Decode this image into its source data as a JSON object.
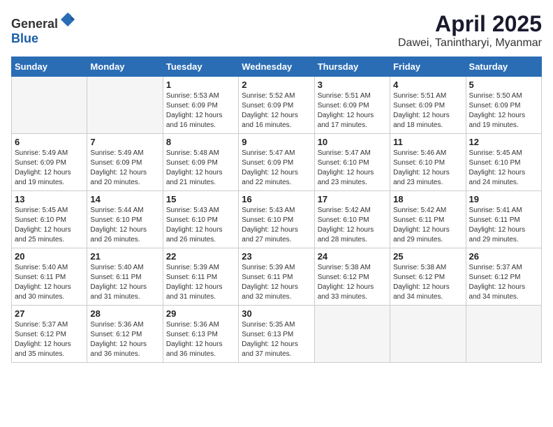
{
  "logo": {
    "text_general": "General",
    "text_blue": "Blue"
  },
  "header": {
    "month": "April 2025",
    "location": "Dawei, Tanintharyi, Myanmar"
  },
  "weekdays": [
    "Sunday",
    "Monday",
    "Tuesday",
    "Wednesday",
    "Thursday",
    "Friday",
    "Saturday"
  ],
  "weeks": [
    [
      {
        "day": "",
        "sunrise": "",
        "sunset": "",
        "daylight": ""
      },
      {
        "day": "",
        "sunrise": "",
        "sunset": "",
        "daylight": ""
      },
      {
        "day": "1",
        "sunrise": "Sunrise: 5:53 AM",
        "sunset": "Sunset: 6:09 PM",
        "daylight": "Daylight: 12 hours and 16 minutes."
      },
      {
        "day": "2",
        "sunrise": "Sunrise: 5:52 AM",
        "sunset": "Sunset: 6:09 PM",
        "daylight": "Daylight: 12 hours and 16 minutes."
      },
      {
        "day": "3",
        "sunrise": "Sunrise: 5:51 AM",
        "sunset": "Sunset: 6:09 PM",
        "daylight": "Daylight: 12 hours and 17 minutes."
      },
      {
        "day": "4",
        "sunrise": "Sunrise: 5:51 AM",
        "sunset": "Sunset: 6:09 PM",
        "daylight": "Daylight: 12 hours and 18 minutes."
      },
      {
        "day": "5",
        "sunrise": "Sunrise: 5:50 AM",
        "sunset": "Sunset: 6:09 PM",
        "daylight": "Daylight: 12 hours and 19 minutes."
      }
    ],
    [
      {
        "day": "6",
        "sunrise": "Sunrise: 5:49 AM",
        "sunset": "Sunset: 6:09 PM",
        "daylight": "Daylight: 12 hours and 19 minutes."
      },
      {
        "day": "7",
        "sunrise": "Sunrise: 5:49 AM",
        "sunset": "Sunset: 6:09 PM",
        "daylight": "Daylight: 12 hours and 20 minutes."
      },
      {
        "day": "8",
        "sunrise": "Sunrise: 5:48 AM",
        "sunset": "Sunset: 6:09 PM",
        "daylight": "Daylight: 12 hours and 21 minutes."
      },
      {
        "day": "9",
        "sunrise": "Sunrise: 5:47 AM",
        "sunset": "Sunset: 6:09 PM",
        "daylight": "Daylight: 12 hours and 22 minutes."
      },
      {
        "day": "10",
        "sunrise": "Sunrise: 5:47 AM",
        "sunset": "Sunset: 6:10 PM",
        "daylight": "Daylight: 12 hours and 23 minutes."
      },
      {
        "day": "11",
        "sunrise": "Sunrise: 5:46 AM",
        "sunset": "Sunset: 6:10 PM",
        "daylight": "Daylight: 12 hours and 23 minutes."
      },
      {
        "day": "12",
        "sunrise": "Sunrise: 5:45 AM",
        "sunset": "Sunset: 6:10 PM",
        "daylight": "Daylight: 12 hours and 24 minutes."
      }
    ],
    [
      {
        "day": "13",
        "sunrise": "Sunrise: 5:45 AM",
        "sunset": "Sunset: 6:10 PM",
        "daylight": "Daylight: 12 hours and 25 minutes."
      },
      {
        "day": "14",
        "sunrise": "Sunrise: 5:44 AM",
        "sunset": "Sunset: 6:10 PM",
        "daylight": "Daylight: 12 hours and 26 minutes."
      },
      {
        "day": "15",
        "sunrise": "Sunrise: 5:43 AM",
        "sunset": "Sunset: 6:10 PM",
        "daylight": "Daylight: 12 hours and 26 minutes."
      },
      {
        "day": "16",
        "sunrise": "Sunrise: 5:43 AM",
        "sunset": "Sunset: 6:10 PM",
        "daylight": "Daylight: 12 hours and 27 minutes."
      },
      {
        "day": "17",
        "sunrise": "Sunrise: 5:42 AM",
        "sunset": "Sunset: 6:10 PM",
        "daylight": "Daylight: 12 hours and 28 minutes."
      },
      {
        "day": "18",
        "sunrise": "Sunrise: 5:42 AM",
        "sunset": "Sunset: 6:11 PM",
        "daylight": "Daylight: 12 hours and 29 minutes."
      },
      {
        "day": "19",
        "sunrise": "Sunrise: 5:41 AM",
        "sunset": "Sunset: 6:11 PM",
        "daylight": "Daylight: 12 hours and 29 minutes."
      }
    ],
    [
      {
        "day": "20",
        "sunrise": "Sunrise: 5:40 AM",
        "sunset": "Sunset: 6:11 PM",
        "daylight": "Daylight: 12 hours and 30 minutes."
      },
      {
        "day": "21",
        "sunrise": "Sunrise: 5:40 AM",
        "sunset": "Sunset: 6:11 PM",
        "daylight": "Daylight: 12 hours and 31 minutes."
      },
      {
        "day": "22",
        "sunrise": "Sunrise: 5:39 AM",
        "sunset": "Sunset: 6:11 PM",
        "daylight": "Daylight: 12 hours and 31 minutes."
      },
      {
        "day": "23",
        "sunrise": "Sunrise: 5:39 AM",
        "sunset": "Sunset: 6:11 PM",
        "daylight": "Daylight: 12 hours and 32 minutes."
      },
      {
        "day": "24",
        "sunrise": "Sunrise: 5:38 AM",
        "sunset": "Sunset: 6:12 PM",
        "daylight": "Daylight: 12 hours and 33 minutes."
      },
      {
        "day": "25",
        "sunrise": "Sunrise: 5:38 AM",
        "sunset": "Sunset: 6:12 PM",
        "daylight": "Daylight: 12 hours and 34 minutes."
      },
      {
        "day": "26",
        "sunrise": "Sunrise: 5:37 AM",
        "sunset": "Sunset: 6:12 PM",
        "daylight": "Daylight: 12 hours and 34 minutes."
      }
    ],
    [
      {
        "day": "27",
        "sunrise": "Sunrise: 5:37 AM",
        "sunset": "Sunset: 6:12 PM",
        "daylight": "Daylight: 12 hours and 35 minutes."
      },
      {
        "day": "28",
        "sunrise": "Sunrise: 5:36 AM",
        "sunset": "Sunset: 6:12 PM",
        "daylight": "Daylight: 12 hours and 36 minutes."
      },
      {
        "day": "29",
        "sunrise": "Sunrise: 5:36 AM",
        "sunset": "Sunset: 6:13 PM",
        "daylight": "Daylight: 12 hours and 36 minutes."
      },
      {
        "day": "30",
        "sunrise": "Sunrise: 5:35 AM",
        "sunset": "Sunset: 6:13 PM",
        "daylight": "Daylight: 12 hours and 37 minutes."
      },
      {
        "day": "",
        "sunrise": "",
        "sunset": "",
        "daylight": ""
      },
      {
        "day": "",
        "sunrise": "",
        "sunset": "",
        "daylight": ""
      },
      {
        "day": "",
        "sunrise": "",
        "sunset": "",
        "daylight": ""
      }
    ]
  ]
}
